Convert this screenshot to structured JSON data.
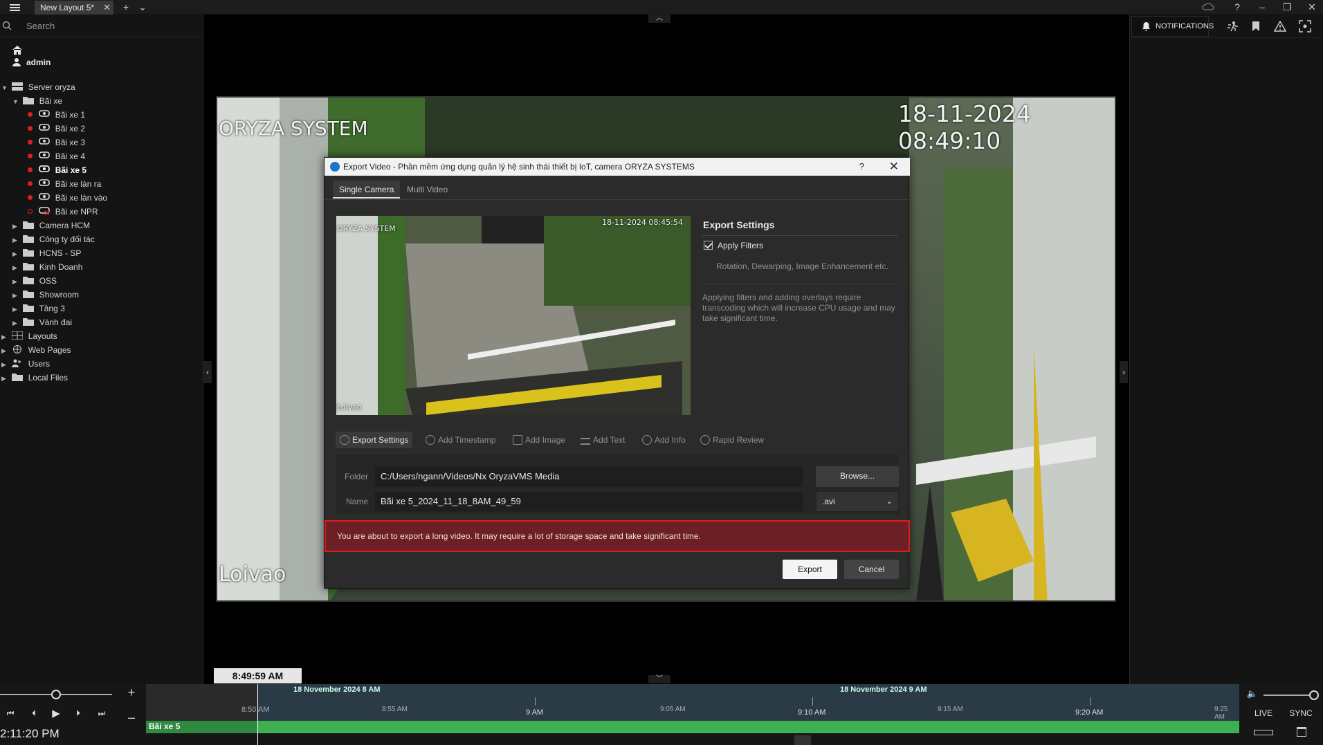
{
  "window": {
    "tab_label": "New Layout 5*",
    "tab_close": "✕",
    "add_tab": "+",
    "tab_menu": "⌄",
    "help": "?",
    "minimize": "–",
    "restore": "❐",
    "close": "✕"
  },
  "left_panel": {
    "search_placeholder": "Search",
    "user": "admin",
    "tree": {
      "server": "Server oryza",
      "group": "Bãi xe",
      "cameras": [
        "Bãi xe 1",
        "Bãi xe 2",
        "Bãi xe 3",
        "Bãi xe 4",
        "Bãi xe 5",
        "Bãi xe làn ra",
        "Bãi xe làn vào",
        "Bãi xe NPR"
      ],
      "folders": [
        "Camera HCM",
        "Công ty đối tác",
        "HCNS - SP",
        "Kinh Doanh",
        "OSS",
        "Showroom",
        "Tầng 3",
        "Vành đai"
      ],
      "roots": [
        "Layouts",
        "Web Pages",
        "Users",
        "Local Files"
      ]
    }
  },
  "right_panel": {
    "notifications_label": "NOTIFICATIONS"
  },
  "video": {
    "overlay_brand": "ORYZA SYSTEM",
    "overlay_timestamp": "18-11-2024 08:49:10",
    "overlay_camera": "Loivao"
  },
  "dialog": {
    "title": "Export Video - Phần mềm ứng dụng quản lý hệ sinh thái thiết bị IoT, camera ORYZA SYSTEMS",
    "help": "?",
    "close": "✕",
    "tabs": [
      "Single Camera",
      "Multi Video"
    ],
    "preview": {
      "brand": "ORYZA SYSTEM",
      "timestamp": "18-11-2024 08:45:54",
      "camera": "Loivao"
    },
    "settings": {
      "heading": "Export Settings",
      "apply_filters": "Apply Filters",
      "filters_detail": "Rotation, Dewarping, Image Enhancement etc.",
      "info": "Applying filters and adding overlays require transcoding which will increase CPU usage and may take significant time."
    },
    "toolbar": [
      "Export Settings",
      "Add Timestamp",
      "Add Image",
      "Add Text",
      "Add Info",
      "Rapid Review"
    ],
    "folder_label": "Folder",
    "folder_value": "C:/Users/ngann/Videos/Nx OryzaVMS Media",
    "browse": "Browse...",
    "name_label": "Name",
    "name_value": "Bãi xe 5_2024_11_18_8AM_49_59",
    "format": ".avi",
    "warning": "You are about to export a long video. It may require a lot of storage space and take significant time.",
    "export": "Export",
    "cancel": "Cancel"
  },
  "timeline": {
    "current_time": "8:49:59 AM",
    "clock": "2:11:20 PM",
    "day_labels": [
      "18 November 2024 8 AM",
      "18 November 2024 9 AM"
    ],
    "time_labels": [
      "8:50 AM",
      "8:55 AM",
      "9 AM",
      "9:05 AM",
      "9:10 AM",
      "9:15 AM",
      "9:20 AM",
      "9:25 AM"
    ],
    "track_label": "Bãi xe 5",
    "live": "LIVE",
    "sync": "SYNC",
    "zoom_in": "+",
    "zoom_out": "–"
  },
  "colors": {
    "accent_blue": "#1a73c8",
    "warning_bg": "#6c1f24",
    "warning_border": "#e01a1a",
    "track_green": "#3db053",
    "status_red": "#e02020"
  }
}
